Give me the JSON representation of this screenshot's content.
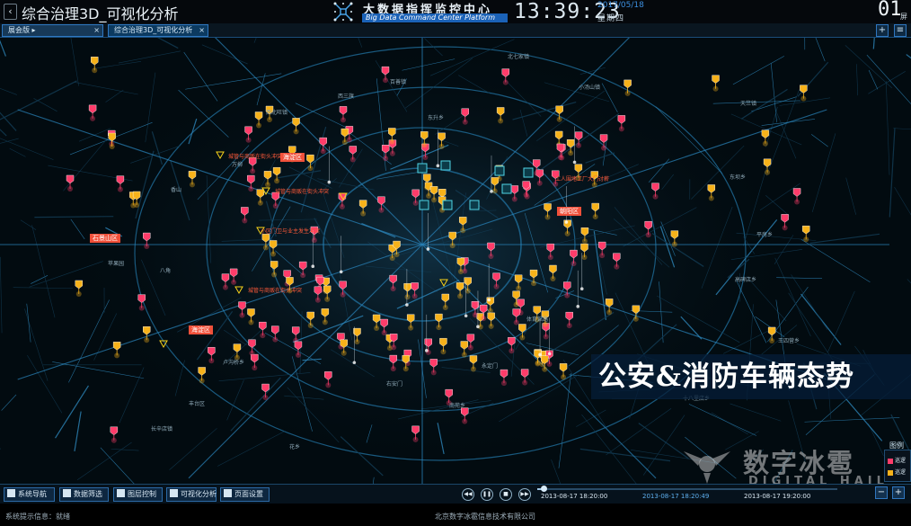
{
  "header": {
    "back_icon": "chevron-left-icon",
    "app_title": "综合治理3D_可视化分析",
    "brand_cn": "大数据指挥监控中心",
    "brand_en": "Big Data Command Center Platform",
    "clock": "13:39:23",
    "date": "2017/05/18",
    "weekday": "星期四",
    "screen_number": "01",
    "screen_unit": "屏"
  },
  "tabs": {
    "items": [
      {
        "label": "展会版 ▸",
        "close": "×"
      },
      {
        "label": "综合治理3D_可视化分析",
        "close": "×"
      }
    ],
    "add": "+",
    "menu": "≡"
  },
  "map": {
    "districts": [
      "海淀区",
      "石景山区",
      "海淀区",
      "朝阳区"
    ],
    "places": [
      "北七家镇",
      "百善镇",
      "西北旺镇",
      "东升乡",
      "万柳",
      "西三旗",
      "小汤山镇",
      "天竺镇",
      "东坝乡",
      "平房乡",
      "高碑店乡",
      "王四营乡",
      "十八里店乡",
      "南苑乡",
      "花乡",
      "卢沟桥乡",
      "右安门",
      "永定门",
      "体育馆路",
      "丰台区",
      "长辛店镇",
      "香山",
      "苹果园",
      "八角"
    ],
    "alerts": [
      "城管与商贩在街头冲突",
      "城管与商贩在街头冲突",
      "小区门卫与业主发生冲突",
      "城管与商贩在街头冲突",
      "工人围堵工厂大门讨薪"
    ],
    "overlay_title": "公安&消防车辆态势",
    "legend_title": "图例",
    "legend_items": [
      "巡逻",
      "巡逻"
    ],
    "watermark_cn": "数字冰雹",
    "watermark_en": "DIGITAL HAIL",
    "colors": {
      "police": "#ff3c6a",
      "fire": "#f7b21a",
      "camera": "#4fd6e6",
      "road": "#1f6d9a",
      "district": "#f0503a"
    }
  },
  "toolbar": {
    "buttons": [
      "系统导航",
      "数据筛选",
      "图层控制",
      "可视化分析",
      "页面设置"
    ],
    "playback": [
      "rewind-icon",
      "pause-icon",
      "stop-icon",
      "forward-icon"
    ],
    "time_start": "2013-08-17 18:20:00",
    "time_current": "2013-08-17 18:20:49",
    "time_end": "2013-08-17 19:20:00",
    "progress": 0.02,
    "zoom_out": "−",
    "zoom_in": "+"
  },
  "status": {
    "text": "系统提示信息：就绪",
    "copyright": "北京数字冰雹信息技术有限公司"
  }
}
